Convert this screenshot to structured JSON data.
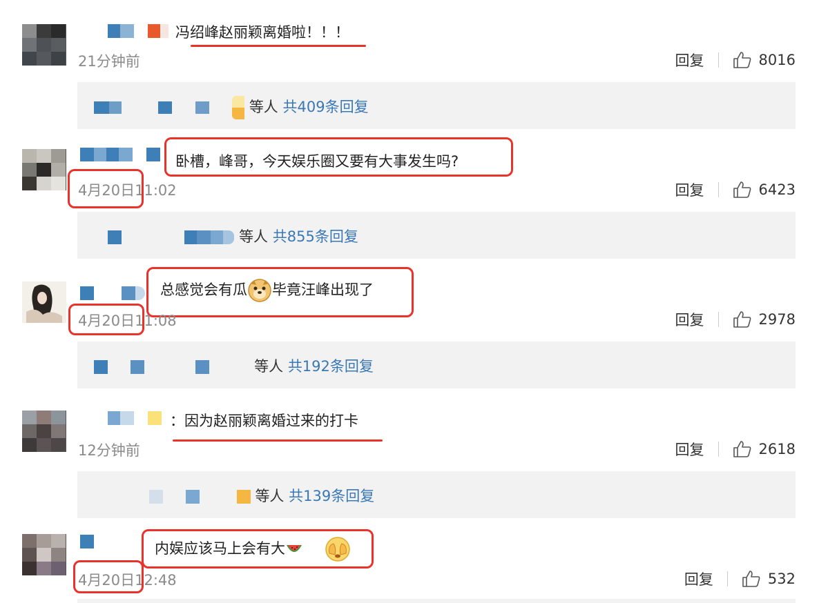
{
  "comments": [
    {
      "text": "冯绍峰赵丽颖离婚啦！！！",
      "time": "21分钟前",
      "reply_label": "回复",
      "likes": "8016",
      "thread": {
        "suffix": "等人",
        "count_text": "共409条回复"
      }
    },
    {
      "text": "卧槽，峰哥，今天娱乐圈又要有大事发生吗?",
      "time_date": "4月20日",
      "time_clock": "11:02",
      "reply_label": "回复",
      "likes": "6423",
      "thread": {
        "suffix": "等人",
        "count_text": "共855条回复"
      }
    },
    {
      "text_before": "总感觉会有瓜",
      "text_after": "毕竟汪峰出现了",
      "time_date": "4月20日",
      "time_clock": "11:08",
      "reply_label": "回复",
      "likes": "2978",
      "thread": {
        "suffix": "等人",
        "count_text": "共192条回复"
      }
    },
    {
      "text": "因为赵丽颖离婚过来的打卡",
      "time": "12分钟前",
      "reply_label": "回复",
      "likes": "2618",
      "thread": {
        "suffix": "等人",
        "count_text": "共139条回复"
      }
    },
    {
      "text": "内娱应该马上会有大",
      "time_date": "4月20日",
      "time_clock": "12:48",
      "reply_label": "回复",
      "likes": "532"
    }
  ],
  "colors": {
    "link": "#3a78b5",
    "highlight": "#e8322a",
    "thread_bg": "#f2f2f2"
  },
  "icons": {
    "like": "thumbs-up-icon",
    "doge": "doge-emoji-icon",
    "watermelon": "watermelon-emoji-icon",
    "face": "covering-face-emoji-icon"
  }
}
